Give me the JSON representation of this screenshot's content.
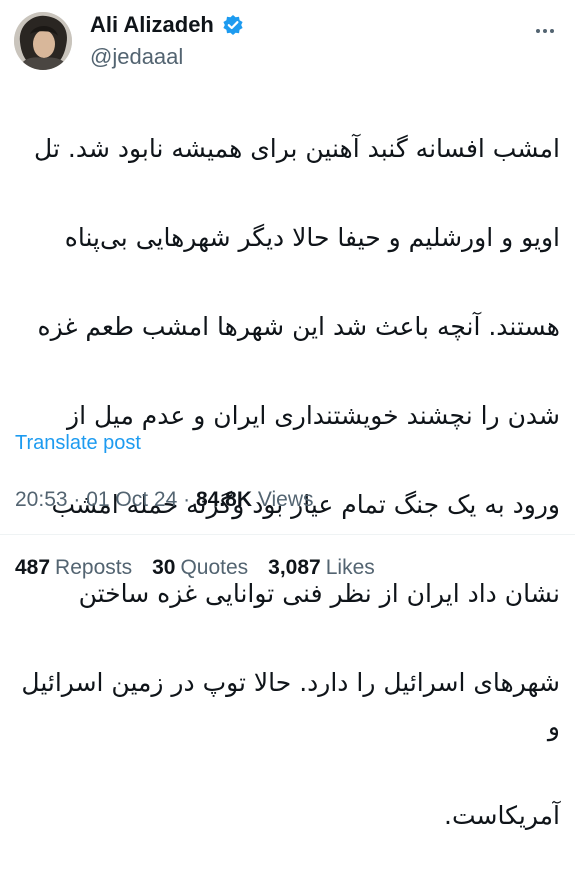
{
  "author": {
    "display_name": "Ali Alizadeh",
    "handle": "@jedaaal"
  },
  "post": {
    "lines": [
      "امشب افسانه گنبد آهنین برای همیشه نابود شد. تل",
      "اویو و اورشلیم و حیفا حالا دیگر شهرهایی بی‌پناه",
      "هستند. آنچه باعث شد این شهرها امشب طعم غزه",
      "شدن را نچشند خویشتنداری ایران و عدم میل از",
      "ورود به یک جنگ تمام عیار بود وگرنه حمله امشب",
      "نشان داد ایران از نظر فنی توانایی غزه ساختن",
      "شهرهای اسرائیل را دارد. حالا توپ در زمین اسرائیل و",
      "آمریکاست."
    ],
    "translate_label": "Translate post"
  },
  "meta": {
    "time": "20:53",
    "date": "01 Oct 24",
    "views_count": "84.8K",
    "views_label": "Views"
  },
  "stats": {
    "reposts_count": "487",
    "reposts_label": "Reposts",
    "quotes_count": "30",
    "quotes_label": "Quotes",
    "likes_count": "3,087",
    "likes_label": "Likes"
  },
  "colors": {
    "accent": "#1d9bf0",
    "secondary_text": "#536471",
    "primary_text": "#0f1419"
  },
  "icons": {
    "verified": "verified-badge-icon",
    "more": "more-options-icon"
  }
}
